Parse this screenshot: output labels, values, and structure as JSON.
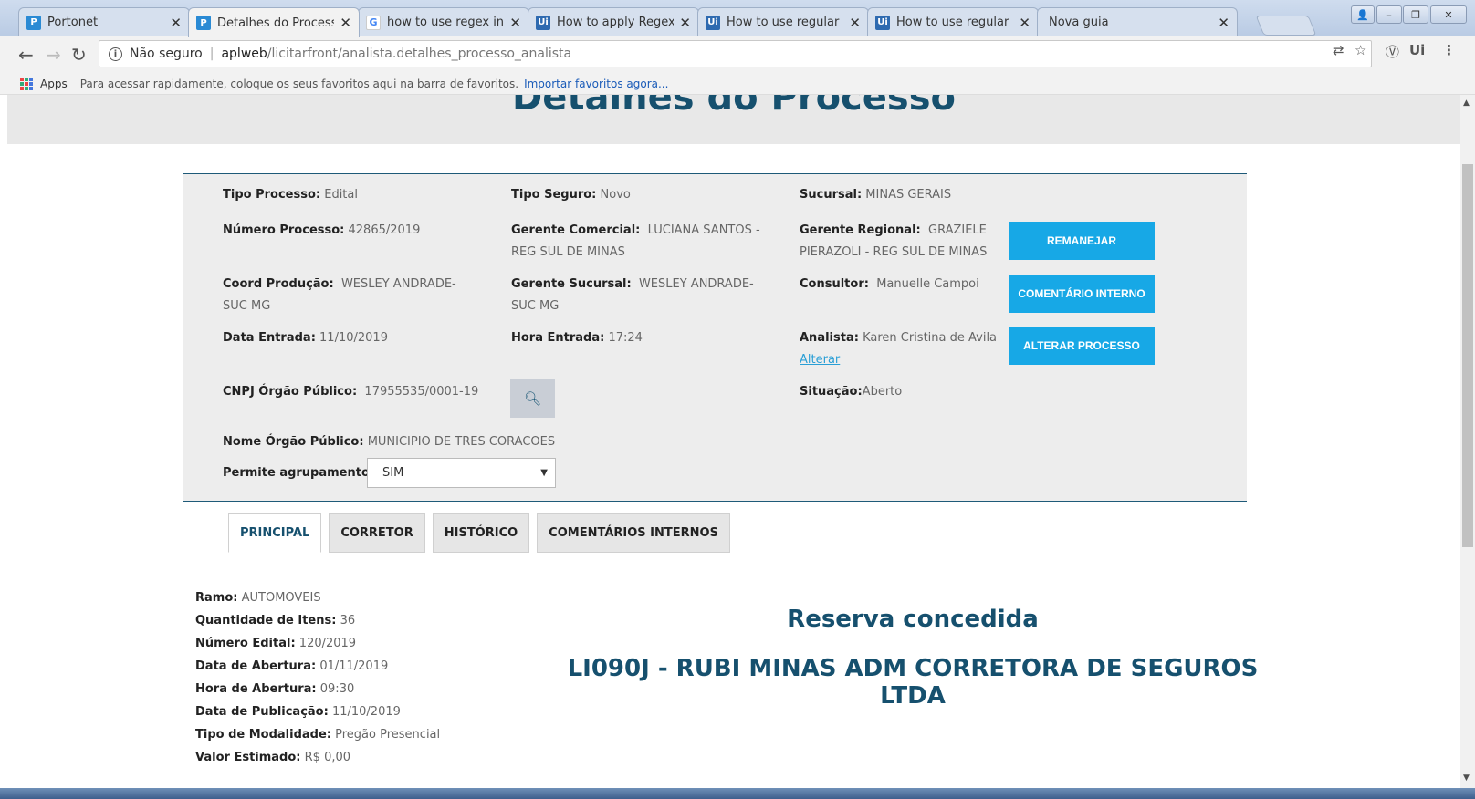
{
  "browser": {
    "tabs": [
      {
        "title": "Portonet",
        "icon": "portonet-icon",
        "active": false
      },
      {
        "title": "Detalhes do Processo",
        "icon": "portonet-icon",
        "active": true
      },
      {
        "title": "how to use regex in uipat",
        "icon": "google-icon",
        "active": false
      },
      {
        "title": "How to apply Regex to sel",
        "icon": "uipath-icon",
        "active": false
      },
      {
        "title": "How to use regular expre",
        "icon": "uipath-icon",
        "active": false
      },
      {
        "title": "How to use regular expre",
        "icon": "uipath-icon",
        "active": false
      },
      {
        "title": "Nova guia",
        "icon": "",
        "active": false
      }
    ],
    "address": {
      "security_label": "Não seguro",
      "host": "aplweb",
      "path": "/licitarfront/analista.detalhes_processo_analista"
    },
    "bookmarks": {
      "apps_label": "Apps",
      "hint": "Para acessar rapidamente, coloque os seus favoritos aqui na barra de favoritos.",
      "import_link": "Importar favoritos agora..."
    }
  },
  "page": {
    "title": "Detalhes do Processo",
    "fields": {
      "tipo_processo": {
        "label": "Tipo Processo:",
        "value": "Edital"
      },
      "tipo_seguro": {
        "label": "Tipo Seguro:",
        "value": "Novo"
      },
      "sucursal": {
        "label": "Sucursal:",
        "value": "MINAS GERAIS"
      },
      "numero_processo": {
        "label": "Número Processo:",
        "value": "42865/2019"
      },
      "gerente_comercial": {
        "label": "Gerente Comercial:",
        "value": "LUCIANA SANTOS - REG SUL DE MINAS"
      },
      "gerente_regional": {
        "label": "Gerente Regional:",
        "value": "GRAZIELE PIERAZOLI - REG SUL DE MINAS"
      },
      "coord_producao": {
        "label": "Coord Produção:",
        "value": "WESLEY ANDRADE- SUC MG"
      },
      "gerente_sucursal": {
        "label": "Gerente Sucursal:",
        "value": "WESLEY ANDRADE- SUC MG"
      },
      "consultor": {
        "label": "Consultor:",
        "value": "Manuelle Campoi"
      },
      "data_entrada": {
        "label": "Data Entrada:",
        "value": "11/10/2019"
      },
      "hora_entrada": {
        "label": "Hora Entrada:",
        "value": "17:24"
      },
      "analista": {
        "label": "Analista:",
        "value": "Karen Cristina de Avila",
        "link": "Alterar"
      },
      "cnpj": {
        "label": "CNPJ Órgão Público:",
        "value": "17955535/0001-19"
      },
      "situacao": {
        "label": "Situação:",
        "value": "Aberto"
      },
      "nome_orgao": {
        "label": "Nome Órgão Público:",
        "value": "MUNICIPIO DE TRES CORACOES"
      },
      "agrupamento": {
        "label": "Permite agrupamento:",
        "value": "SIM"
      }
    },
    "buttons": {
      "remanejar": "REMANEJAR",
      "comentario": "COMENTÁRIO INTERNO",
      "alterar": "ALTERAR PROCESSO"
    },
    "tabs": [
      "PRINCIPAL",
      "CORRETOR",
      "HISTÓRICO",
      "COMENTÁRIOS INTERNOS"
    ],
    "active_tab": "PRINCIPAL",
    "details": [
      {
        "label": "Ramo:",
        "value": "AUTOMOVEIS"
      },
      {
        "label": "Quantidade de Itens:",
        "value": "36"
      },
      {
        "label": "Número Edital:",
        "value": "120/2019"
      },
      {
        "label": "Data de Abertura:",
        "value": "01/11/2019"
      },
      {
        "label": "Hora de Abertura:",
        "value": "09:30"
      },
      {
        "label": "Data de Publicação:",
        "value": "11/10/2019"
      },
      {
        "label": "Tipo de Modalidade:",
        "value": "Pregão Presencial"
      },
      {
        "label": "Valor Estimado:",
        "value": "R$ 0,00"
      }
    ],
    "reserva": "Reserva concedida",
    "corretora": "LI090J - RUBI MINAS ADM CORRETORA DE SEGUROS LTDA"
  },
  "colors": {
    "accent": "#17a8e6",
    "title": "#16506e"
  }
}
